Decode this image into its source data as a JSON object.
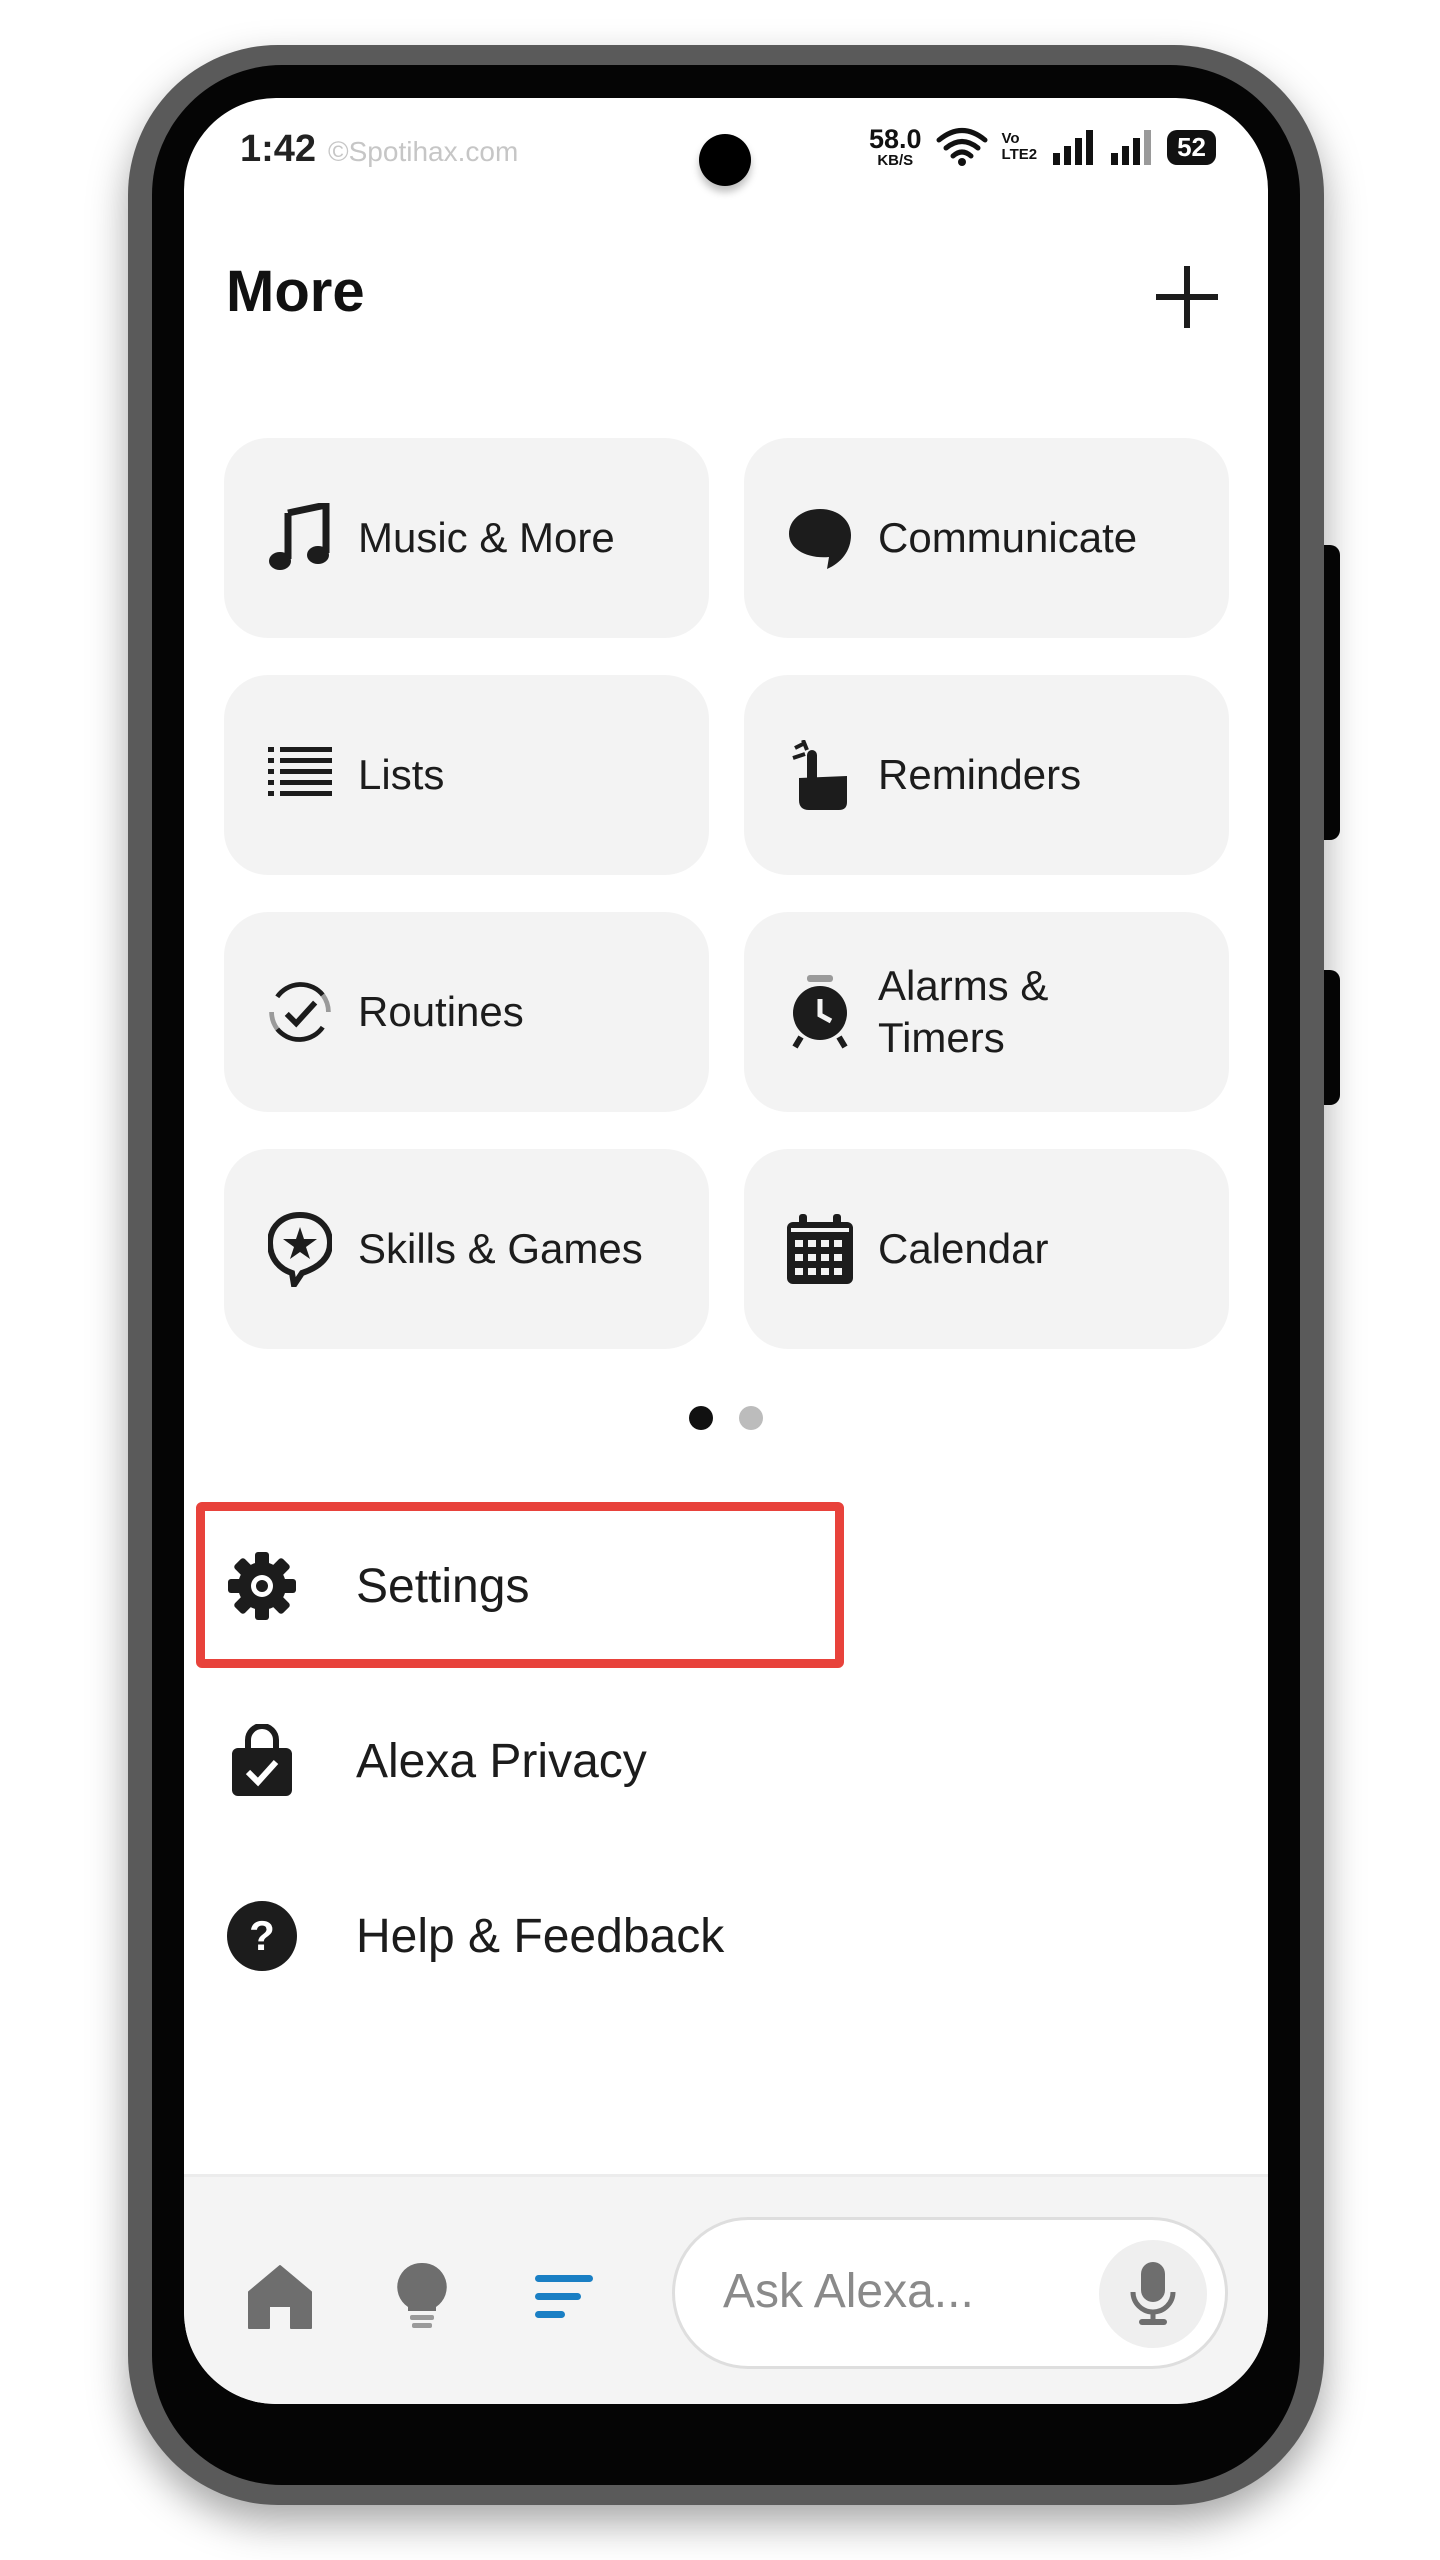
{
  "status_bar": {
    "time": "1:42",
    "watermark": "©Spotihax.com",
    "net_speed": "58.0",
    "net_unit": "KB/S",
    "volte_top": "Vo",
    "volte_bottom": "LTE2",
    "battery": "52"
  },
  "header": {
    "title": "More",
    "add_icon": "plus-icon"
  },
  "tiles": [
    {
      "label": "Music & More",
      "icon": "music-note-icon"
    },
    {
      "label": "Communicate",
      "icon": "chat-bubble-icon"
    },
    {
      "label": "Lists",
      "icon": "list-icon"
    },
    {
      "label": "Reminders",
      "icon": "reminder-hand-icon"
    },
    {
      "label": "Routines",
      "icon": "routines-icon"
    },
    {
      "label": "Alarms & Timers",
      "icon": "alarm-clock-icon"
    },
    {
      "label": "Skills & Games",
      "icon": "skills-star-icon"
    },
    {
      "label": "Calendar",
      "icon": "calendar-icon"
    }
  ],
  "pager": {
    "pages": 2,
    "active": 0
  },
  "menu": [
    {
      "label": "Settings",
      "icon": "gear-icon",
      "highlighted": true
    },
    {
      "label": "Alexa Privacy",
      "icon": "privacy-lock-icon"
    },
    {
      "label": "Help & Feedback",
      "icon": "help-icon"
    }
  ],
  "bottom_nav": {
    "items": [
      {
        "icon": "home-icon"
      },
      {
        "icon": "lightbulb-icon"
      },
      {
        "icon": "more-menu-icon",
        "active": true
      }
    ],
    "ask_placeholder": "Ask Alexa...",
    "mic_icon": "microphone-icon"
  },
  "colors": {
    "highlight": "#e8423b",
    "active_nav": "#1a7fc4",
    "tile_bg": "#f3f3f3"
  }
}
